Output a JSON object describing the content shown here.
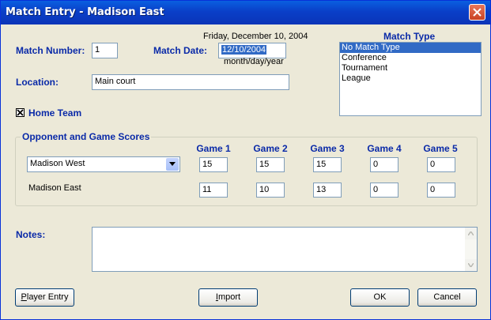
{
  "window": {
    "title": "Match Entry - Madison East"
  },
  "form": {
    "date_display": "Friday, December 10, 2004",
    "match_number_label": "Match Number:",
    "match_number": "1",
    "match_date_label": "Match Date:",
    "match_date": "12/10/2004",
    "date_hint": "month/day/year",
    "location_label": "Location:",
    "location": "Main court",
    "home_team_label": "Home Team",
    "home_team_checked": true,
    "match_type_label": "Match Type",
    "match_types": [
      {
        "label": "No Match Type",
        "selected": true
      },
      {
        "label": "Conference",
        "selected": false
      },
      {
        "label": "Tournament",
        "selected": false
      },
      {
        "label": "League",
        "selected": false
      }
    ]
  },
  "scores": {
    "group_title": "Opponent and Game Scores",
    "game_headers": [
      "Game 1",
      "Game 2",
      "Game 3",
      "Game 4",
      "Game 5"
    ],
    "opponent": "Madison West",
    "home_team": "Madison East",
    "opponent_scores": [
      "15",
      "15",
      "15",
      "0",
      "0"
    ],
    "home_scores": [
      "11",
      "10",
      "13",
      "0",
      "0"
    ]
  },
  "notes": {
    "label": "Notes:",
    "value": ""
  },
  "buttons": {
    "player_entry_ul": "P",
    "player_entry_rest": "layer Entry",
    "import_ul": "I",
    "import_rest": "mport",
    "ok": "OK",
    "cancel": "Cancel"
  },
  "colors": {
    "titlebar": "#0a3fc8",
    "label_blue": "#0a2aa8",
    "selection": "#316ac5",
    "face": "#ece9d8"
  }
}
